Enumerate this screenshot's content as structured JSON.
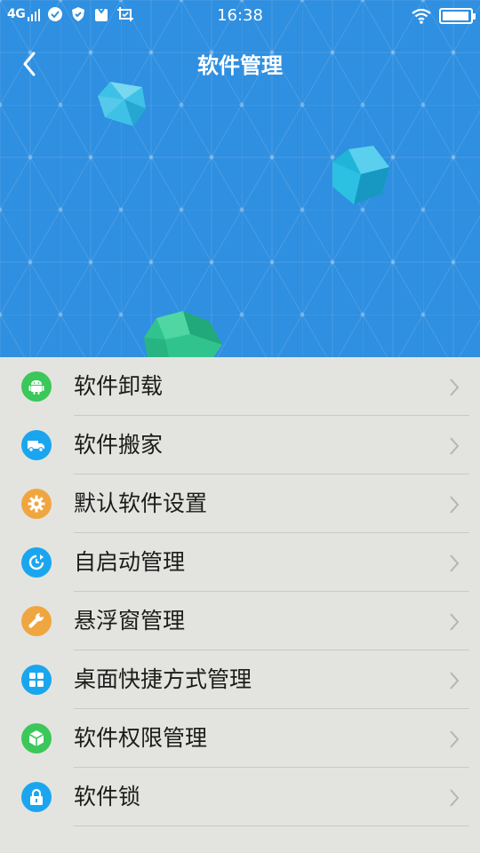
{
  "status_bar": {
    "network": "4G",
    "time": "16:38",
    "battery_level": 0.95
  },
  "header": {
    "title": "软件管理",
    "background_color": "#2f8fe0"
  },
  "menu": [
    {
      "label": "软件卸载",
      "icon": "android-icon",
      "color": "#3cc75a"
    },
    {
      "label": "软件搬家",
      "icon": "truck-icon",
      "color": "#1aa6ef"
    },
    {
      "label": "默认软件设置",
      "icon": "gear-icon",
      "color": "#f0a640"
    },
    {
      "label": "自启动管理",
      "icon": "clock-refresh-icon",
      "color": "#1aa6ef"
    },
    {
      "label": "悬浮窗管理",
      "icon": "wrench-icon",
      "color": "#f0a640"
    },
    {
      "label": "桌面快捷方式管理",
      "icon": "grid-icon",
      "color": "#1aa6ef"
    },
    {
      "label": "软件权限管理",
      "icon": "cube-icon",
      "color": "#3cc75a"
    },
    {
      "label": "软件锁",
      "icon": "lock-icon",
      "color": "#1aa6ef"
    }
  ]
}
